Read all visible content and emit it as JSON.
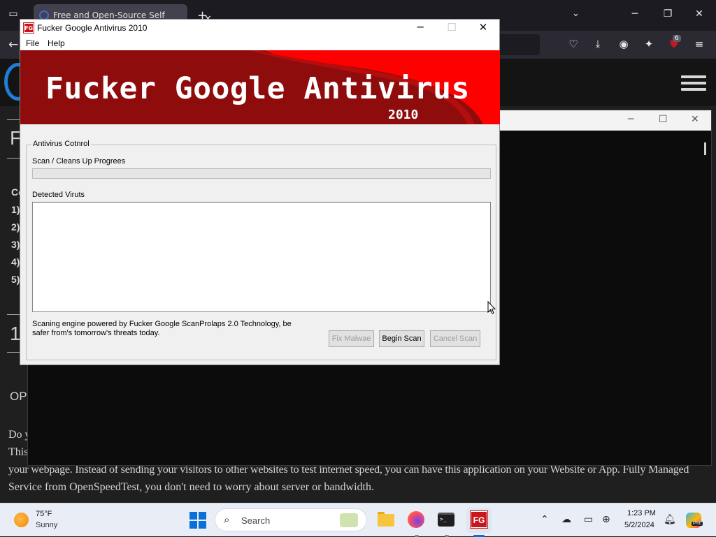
{
  "browser": {
    "tab_title": "Free and Open-Source Self-Ho",
    "tab_close": "✕",
    "new_tab": "+",
    "extension_badge": "6",
    "page": {
      "big_letter_1": "F",
      "heading_fragment": "Co",
      "list_numbers": [
        "1)",
        "2)",
        "3)",
        "4)",
        "5)"
      ],
      "big_letter_2": "1",
      "opt_fragment": "OPT",
      "para_fragment_1": "Do y",
      "para_fragment_2": "This",
      "para_line_3": "your webpage. Instead of sending your visitors to other websites to test internet speed, you can have this application on your Website or App. Fully Managed",
      "para_line_4": "Service from OpenSpeedTest, you don't need to worry about server or bandwidth."
    }
  },
  "av_window": {
    "title": "Fucker Google Antivirus 2010",
    "app_icon_text": "FG",
    "menu": {
      "file": "File",
      "help": "Help"
    },
    "banner": {
      "title": "Fucker Google Antivirus",
      "year": "2010"
    },
    "group_title": "Antivirus Cotnrol",
    "progress_label": "Scan / Cleans Up Progrees",
    "progress_value": 0,
    "detected_label": "Detected Viruts",
    "detected_items": [],
    "footer_note": "Scaning engine powered by Fucker Google ScanProlaps 2.0 Technology, be safer from's tomorrow's threats today.",
    "buttons": {
      "fix": "Fix Malwae",
      "begin": "Begin Scan",
      "cancel": "Cancel Scan"
    },
    "colors": {
      "banner_dark": "#8e0c0c",
      "banner_bright": "#ff0000",
      "progress": "#06b025"
    }
  },
  "taskbar": {
    "weather_temp": "75°F",
    "weather_cond": "Sunny",
    "search_placeholder": "Search",
    "av_icon_text": "FG",
    "clock_time": "1:23 PM",
    "clock_date": "5/2/2024",
    "copilot_badge": "PRE"
  }
}
